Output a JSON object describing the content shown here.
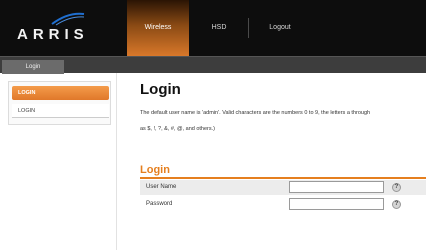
{
  "brand": {
    "logo_text": "ARRIS"
  },
  "nav": {
    "items": [
      {
        "label": "Wireless",
        "active": true
      },
      {
        "label": "HSD",
        "active": false
      },
      {
        "label": "Logout",
        "active": false
      }
    ]
  },
  "subnav": {
    "tab": "Login"
  },
  "sidebar": {
    "items": [
      {
        "label": "LOGIN"
      },
      {
        "label": "LOGIN"
      }
    ]
  },
  "main": {
    "title": "Login",
    "description_line1": "The default user name is 'admin'. Valid characters are the numbers 0 to 9, the letters a through",
    "description_line2": "as $, !, ?, &, #, @, and others.)",
    "section_title": "Login",
    "fields": [
      {
        "label": "User Name",
        "value": ""
      },
      {
        "label": "Password",
        "value": ""
      }
    ],
    "help_glyph": "?"
  },
  "colors": {
    "accent": "#e57f1f",
    "topbar": "#0d0d0d",
    "subbar": "#3d3d3d"
  }
}
